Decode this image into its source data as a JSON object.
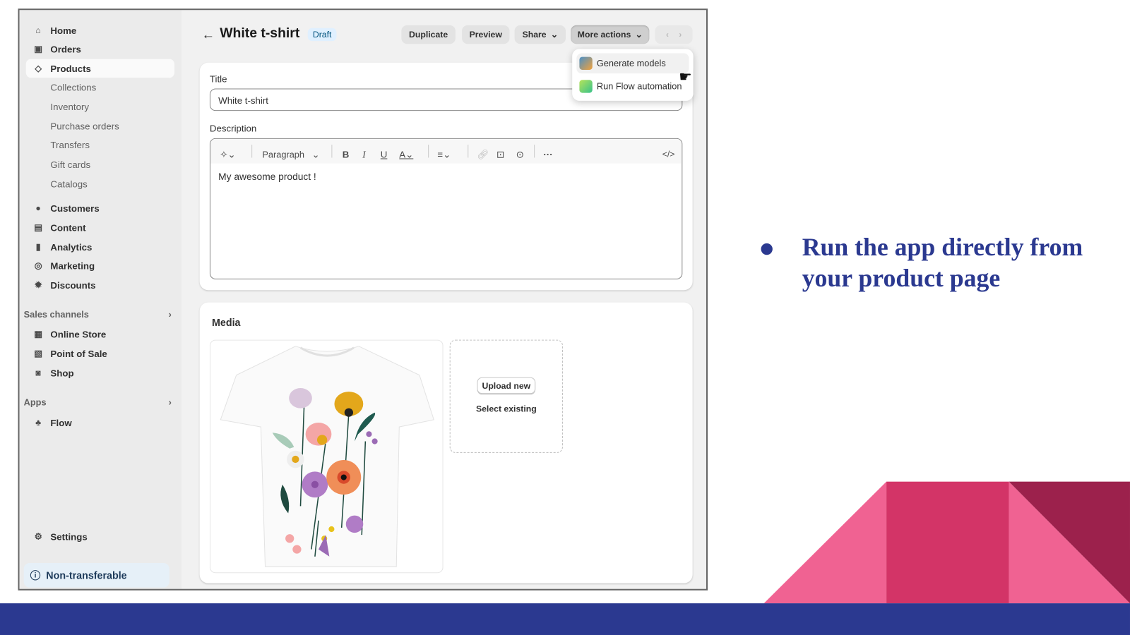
{
  "sidebar": {
    "items": [
      {
        "label": "Home",
        "icon": "home-icon"
      },
      {
        "label": "Orders",
        "icon": "inbox-icon"
      },
      {
        "label": "Products",
        "icon": "tag-icon",
        "active": true
      }
    ],
    "product_sub": [
      "Collections",
      "Inventory",
      "Purchase orders",
      "Transfers",
      "Gift cards",
      "Catalogs"
    ],
    "items2": [
      {
        "label": "Customers",
        "icon": "person-icon"
      },
      {
        "label": "Content",
        "icon": "content-icon"
      },
      {
        "label": "Analytics",
        "icon": "bar-chart-icon"
      },
      {
        "label": "Marketing",
        "icon": "target-icon"
      },
      {
        "label": "Discounts",
        "icon": "discount-icon"
      }
    ],
    "sales_channels_label": "Sales channels",
    "sales_channels": [
      {
        "label": "Online Store",
        "icon": "store-icon"
      },
      {
        "label": "Point of Sale",
        "icon": "pos-icon"
      },
      {
        "label": "Shop",
        "icon": "shop-icon"
      }
    ],
    "apps_label": "Apps",
    "apps": [
      {
        "label": "Flow",
        "icon": "flow-icon"
      }
    ],
    "settings": "Settings",
    "non_transferable": "Non-transferable"
  },
  "header": {
    "title": "White t-shirt",
    "status": "Draft",
    "buttons": {
      "duplicate": "Duplicate",
      "preview": "Preview",
      "share": "Share",
      "more_actions": "More actions"
    }
  },
  "more_actions_menu": [
    {
      "label": "Generate models",
      "icon": "generate-models-app-icon"
    },
    {
      "label": "Run Flow automation",
      "icon": "flow-app-icon"
    }
  ],
  "form": {
    "title_label": "Title",
    "title_value": "White t-shirt",
    "description_label": "Description",
    "paragraph_select": "Paragraph",
    "description_value": "My awesome product !"
  },
  "media": {
    "heading": "Media",
    "upload_new": "Upload new",
    "select_existing": "Select existing"
  },
  "slide": {
    "bullet_line1": "Run the app directly from",
    "bullet_line2": "your product page",
    "colors": {
      "navy": "#2b3990",
      "pink": "#f06292",
      "magenta": "#d33467",
      "maroon": "#9c214c"
    }
  }
}
